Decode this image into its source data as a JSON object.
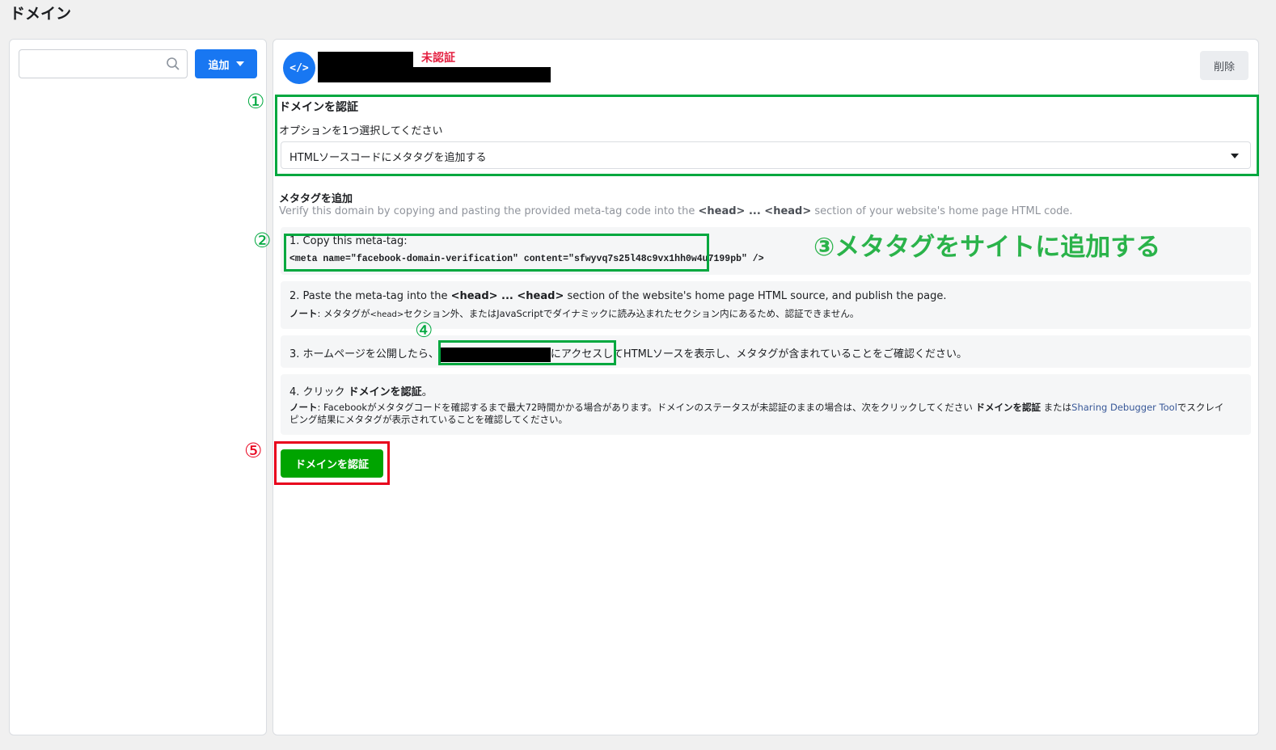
{
  "page": {
    "title": "ドメイン"
  },
  "sidebar": {
    "search_value": "",
    "add_label": "追加"
  },
  "header": {
    "status": "未認証",
    "delete_label": "削除"
  },
  "verify": {
    "heading": "ドメインを認証",
    "option_prompt": "オプションを1つ選択してください",
    "selected_option": "HTMLソースコードにメタタグを追加する"
  },
  "metatag": {
    "heading": "メタタグを追加",
    "desc_prefix": "Verify this domain by copying and pasting the provided meta-tag code into the ",
    "desc_head1": "<head>",
    "desc_dots": " ... ",
    "desc_head2": "<head>",
    "desc_suffix": " section of your website's home page HTML code."
  },
  "steps": {
    "step1_label": "1. Copy this meta-tag:",
    "step1_code": "<meta name=\"facebook-domain-verification\" content=\"sfwyvq7s25l48c9vx1hh0w4u7199pb\" />",
    "step2_prefix": "2. Paste the meta-tag into the ",
    "step2_head1": "<head>",
    "step2_dots": " ... ",
    "step2_head2": "<head>",
    "step2_suffix": " section of the website's home page HTML source, and publish the page.",
    "step2_note_label": "ノート",
    "step2_note_a": ": メタタグが",
    "step2_note_head": "<head>",
    "step2_note_b": "セクション外、またはJavaScriptでダイナミックに読み込まれたセクション内にあるため、認証できません。",
    "step3_prefix": "3. ホームページを公開したら、",
    "step3_suffix": "にアクセスしてHTMLソースを表示し、メタタグが含まれていることをご確認ください。",
    "step4_prefix": "4. クリック ",
    "step4_bold": "ドメインを認証",
    "step4_end": "。",
    "step4_note_label": "ノート",
    "step4_note_a": ": Facebookがメタタグコードを確認するまで最大72時間かかる場合があります。ドメインのステータスが未認証のままの場合は、次をクリックしてください ",
    "step4_note_bold": "ドメインを認証",
    "step4_note_b": " または",
    "step4_note_link": "Sharing Debugger Tool",
    "step4_note_c": "でスクレイ",
    "step4_note_line2": "ピング結果にメタタグが表示されていることを確認してください。"
  },
  "verify_button_label": "ドメインを認証",
  "annotations": {
    "n1": "①",
    "n2": "②",
    "n3_label": "③メタタグをサイトに追加する",
    "n4": "④",
    "n5": "⑤"
  },
  "colors": {
    "accent": "#1877f2",
    "verify": "#00a400",
    "annotation_green": "#00a83f",
    "annotation_red": "#e8001c",
    "status": "#e41e3f"
  }
}
